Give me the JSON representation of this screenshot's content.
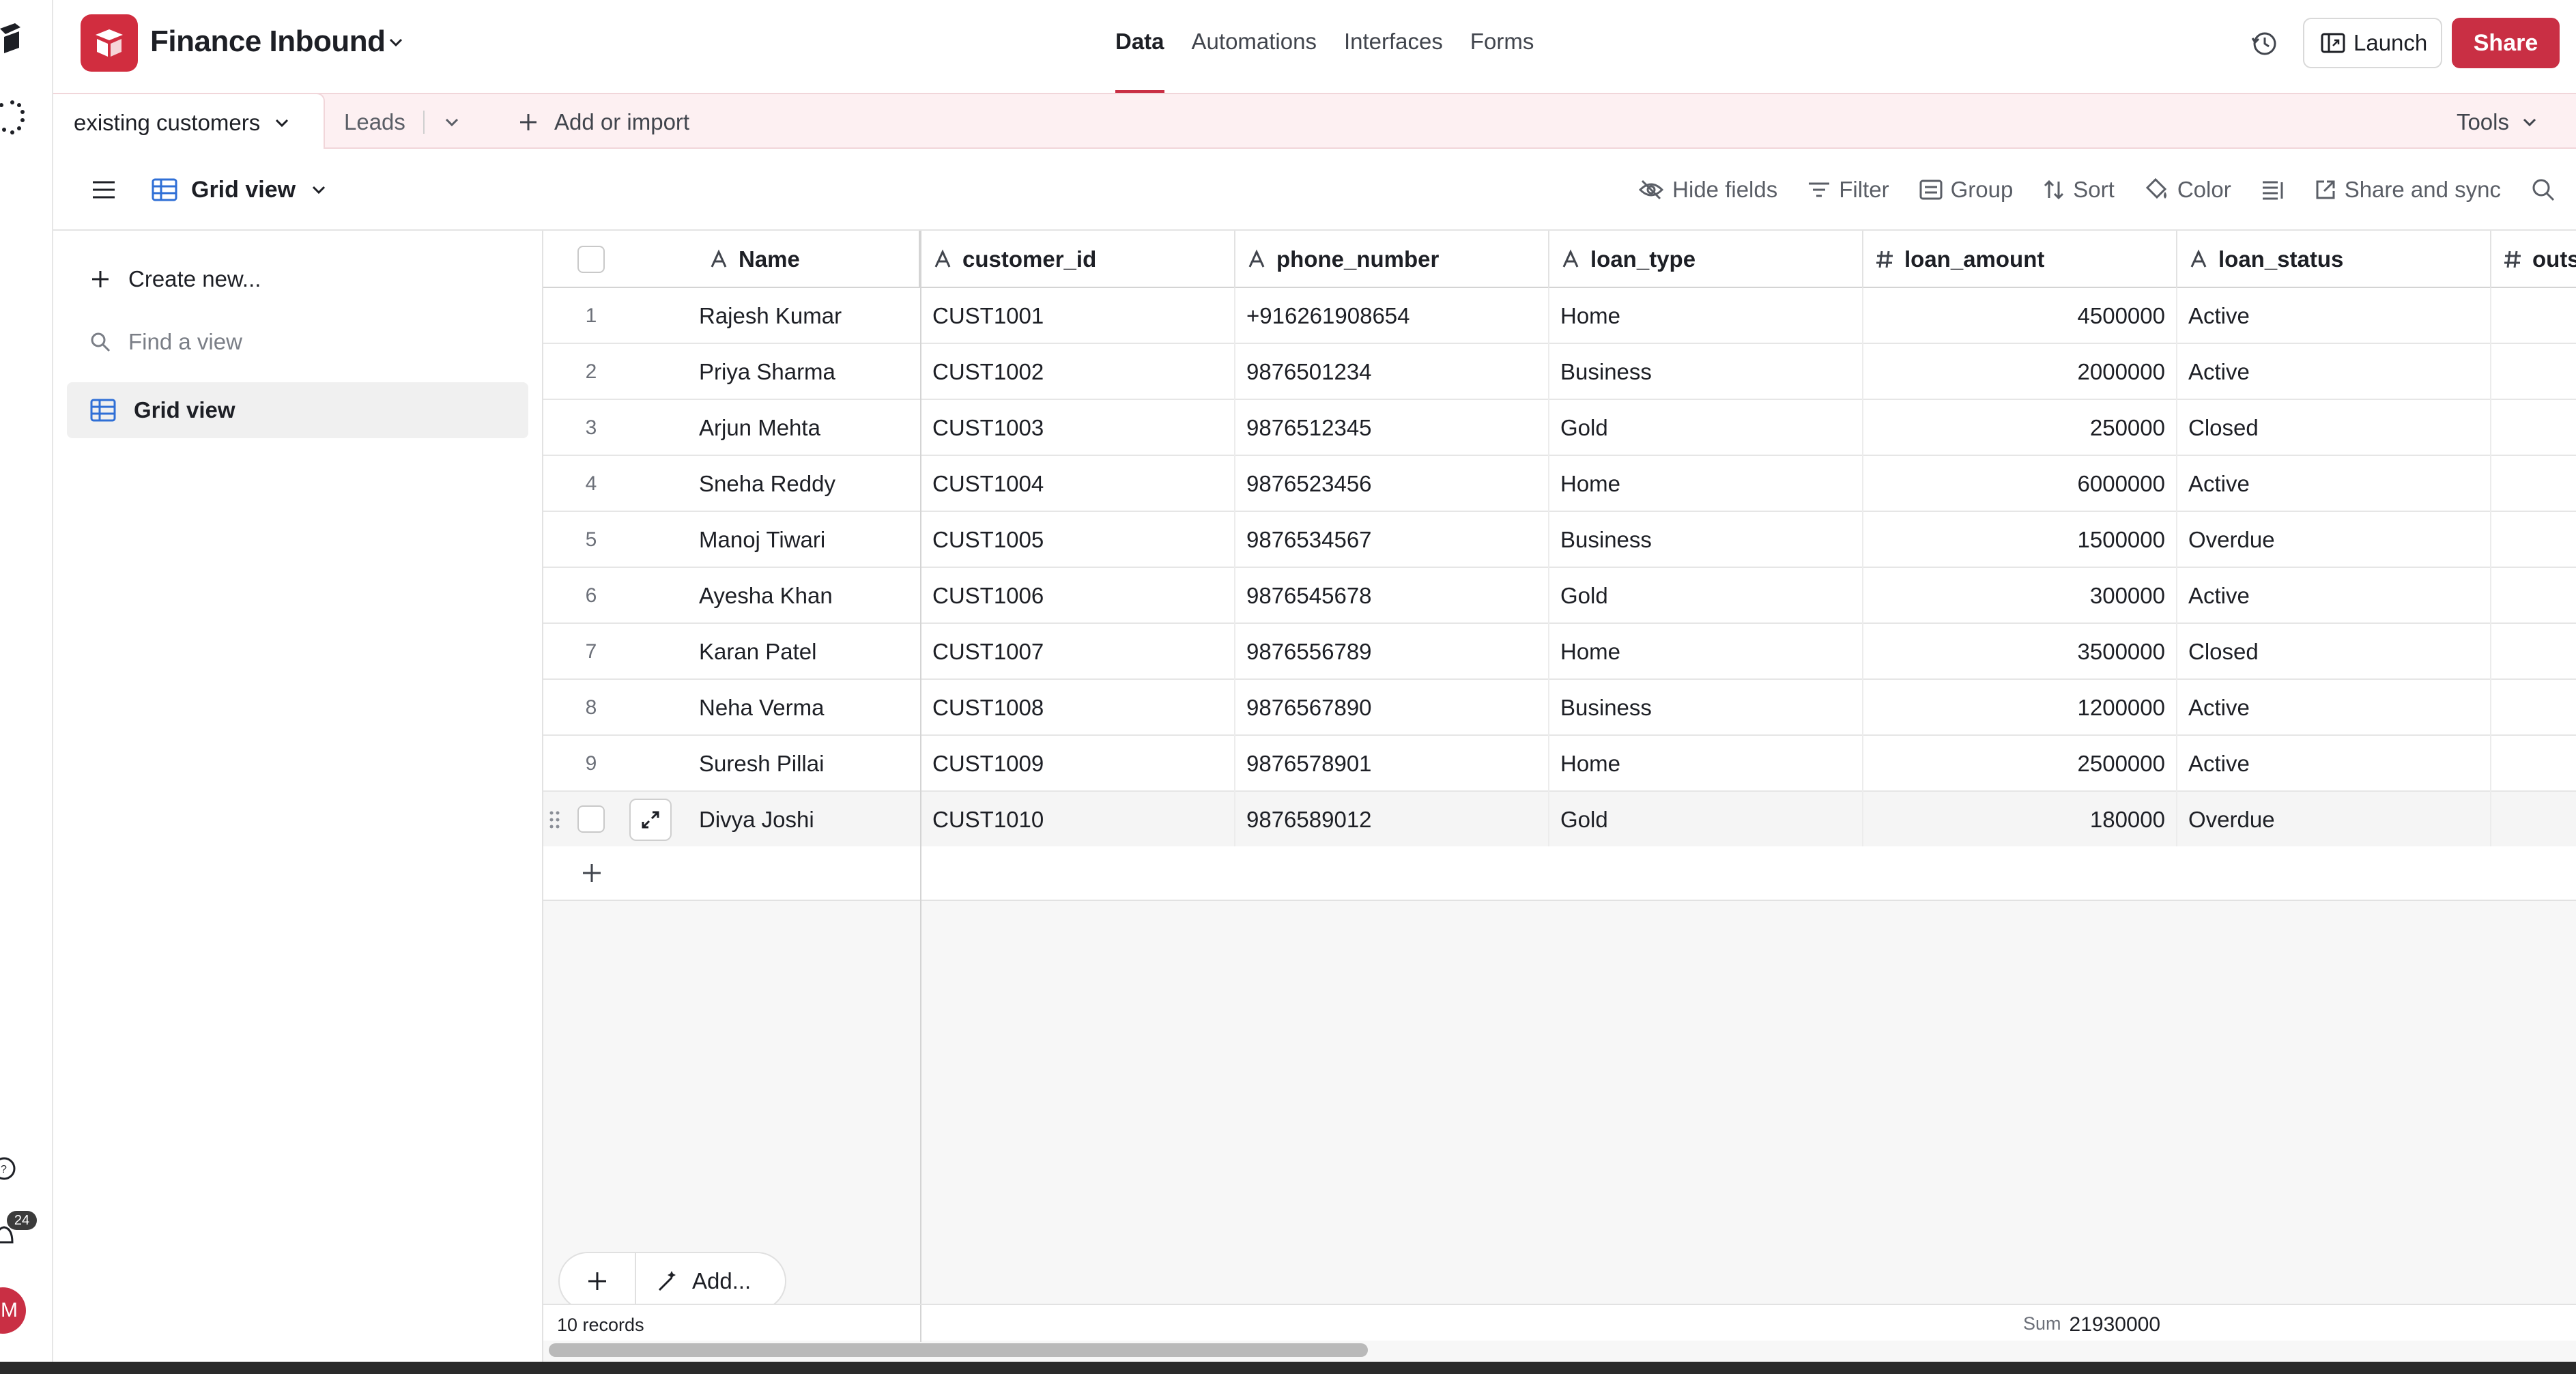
{
  "app": {
    "base_name": "Finance Inbound",
    "nav_tabs": [
      {
        "label": "Data",
        "active": true
      },
      {
        "label": "Automations",
        "active": false
      },
      {
        "label": "Interfaces",
        "active": false
      },
      {
        "label": "Forms",
        "active": false
      }
    ],
    "launch_label": "Launch",
    "share_label": "Share",
    "brand_color": "#c92f44",
    "notification_count": "24",
    "avatar_initial": "M"
  },
  "tables": {
    "active": "existing customers",
    "other": "Leads",
    "add_import": "Add or import",
    "tools": "Tools"
  },
  "view": {
    "name": "Grid view",
    "toolbar": {
      "hide_fields": "Hide fields",
      "filter": "Filter",
      "group": "Group",
      "sort": "Sort",
      "color": "Color",
      "share_sync": "Share and sync"
    }
  },
  "sidebar": {
    "create_new": "Create new...",
    "find_placeholder": "Find a view",
    "views": [
      "Grid view"
    ]
  },
  "grid": {
    "columns": [
      {
        "label": "Name",
        "type_icon": "text-icon"
      },
      {
        "label": "customer_id",
        "type_icon": "text-icon"
      },
      {
        "label": "phone_number",
        "type_icon": "text-icon"
      },
      {
        "label": "loan_type",
        "type_icon": "text-icon"
      },
      {
        "label": "loan_amount",
        "type_icon": "number-icon"
      },
      {
        "label": "loan_status",
        "type_icon": "text-icon"
      },
      {
        "label": "outs",
        "type_icon": "number-icon"
      }
    ],
    "rows": [
      {
        "n": "1",
        "name": "Rajesh Kumar",
        "id": "CUST1001",
        "phone": "+916261908654",
        "type": "Home",
        "amount": "4500000",
        "status": "Active"
      },
      {
        "n": "2",
        "name": "Priya Sharma",
        "id": "CUST1002",
        "phone": "9876501234",
        "type": "Business",
        "amount": "2000000",
        "status": "Active"
      },
      {
        "n": "3",
        "name": "Arjun Mehta",
        "id": "CUST1003",
        "phone": "9876512345",
        "type": "Gold",
        "amount": "250000",
        "status": "Closed"
      },
      {
        "n": "4",
        "name": "Sneha Reddy",
        "id": "CUST1004",
        "phone": "9876523456",
        "type": "Home",
        "amount": "6000000",
        "status": "Active"
      },
      {
        "n": "5",
        "name": "Manoj Tiwari",
        "id": "CUST1005",
        "phone": "9876534567",
        "type": "Business",
        "amount": "1500000",
        "status": "Overdue"
      },
      {
        "n": "6",
        "name": "Ayesha Khan",
        "id": "CUST1006",
        "phone": "9876545678",
        "type": "Gold",
        "amount": "300000",
        "status": "Active"
      },
      {
        "n": "7",
        "name": "Karan Patel",
        "id": "CUST1007",
        "phone": "9876556789",
        "type": "Home",
        "amount": "3500000",
        "status": "Closed"
      },
      {
        "n": "8",
        "name": "Neha Verma",
        "id": "CUST1008",
        "phone": "9876567890",
        "type": "Business",
        "amount": "1200000",
        "status": "Active"
      },
      {
        "n": "9",
        "name": "Suresh Pillai",
        "id": "CUST1009",
        "phone": "9876578901",
        "type": "Home",
        "amount": "2500000",
        "status": "Active"
      },
      {
        "n": "",
        "name": "Divya Joshi",
        "id": "CUST1010",
        "phone": "9876589012",
        "type": "Gold",
        "amount": "180000",
        "status": "Overdue"
      }
    ],
    "add_label": "Add...",
    "record_count": "10 records",
    "sum_label": "Sum",
    "sum_value": "21930000"
  }
}
